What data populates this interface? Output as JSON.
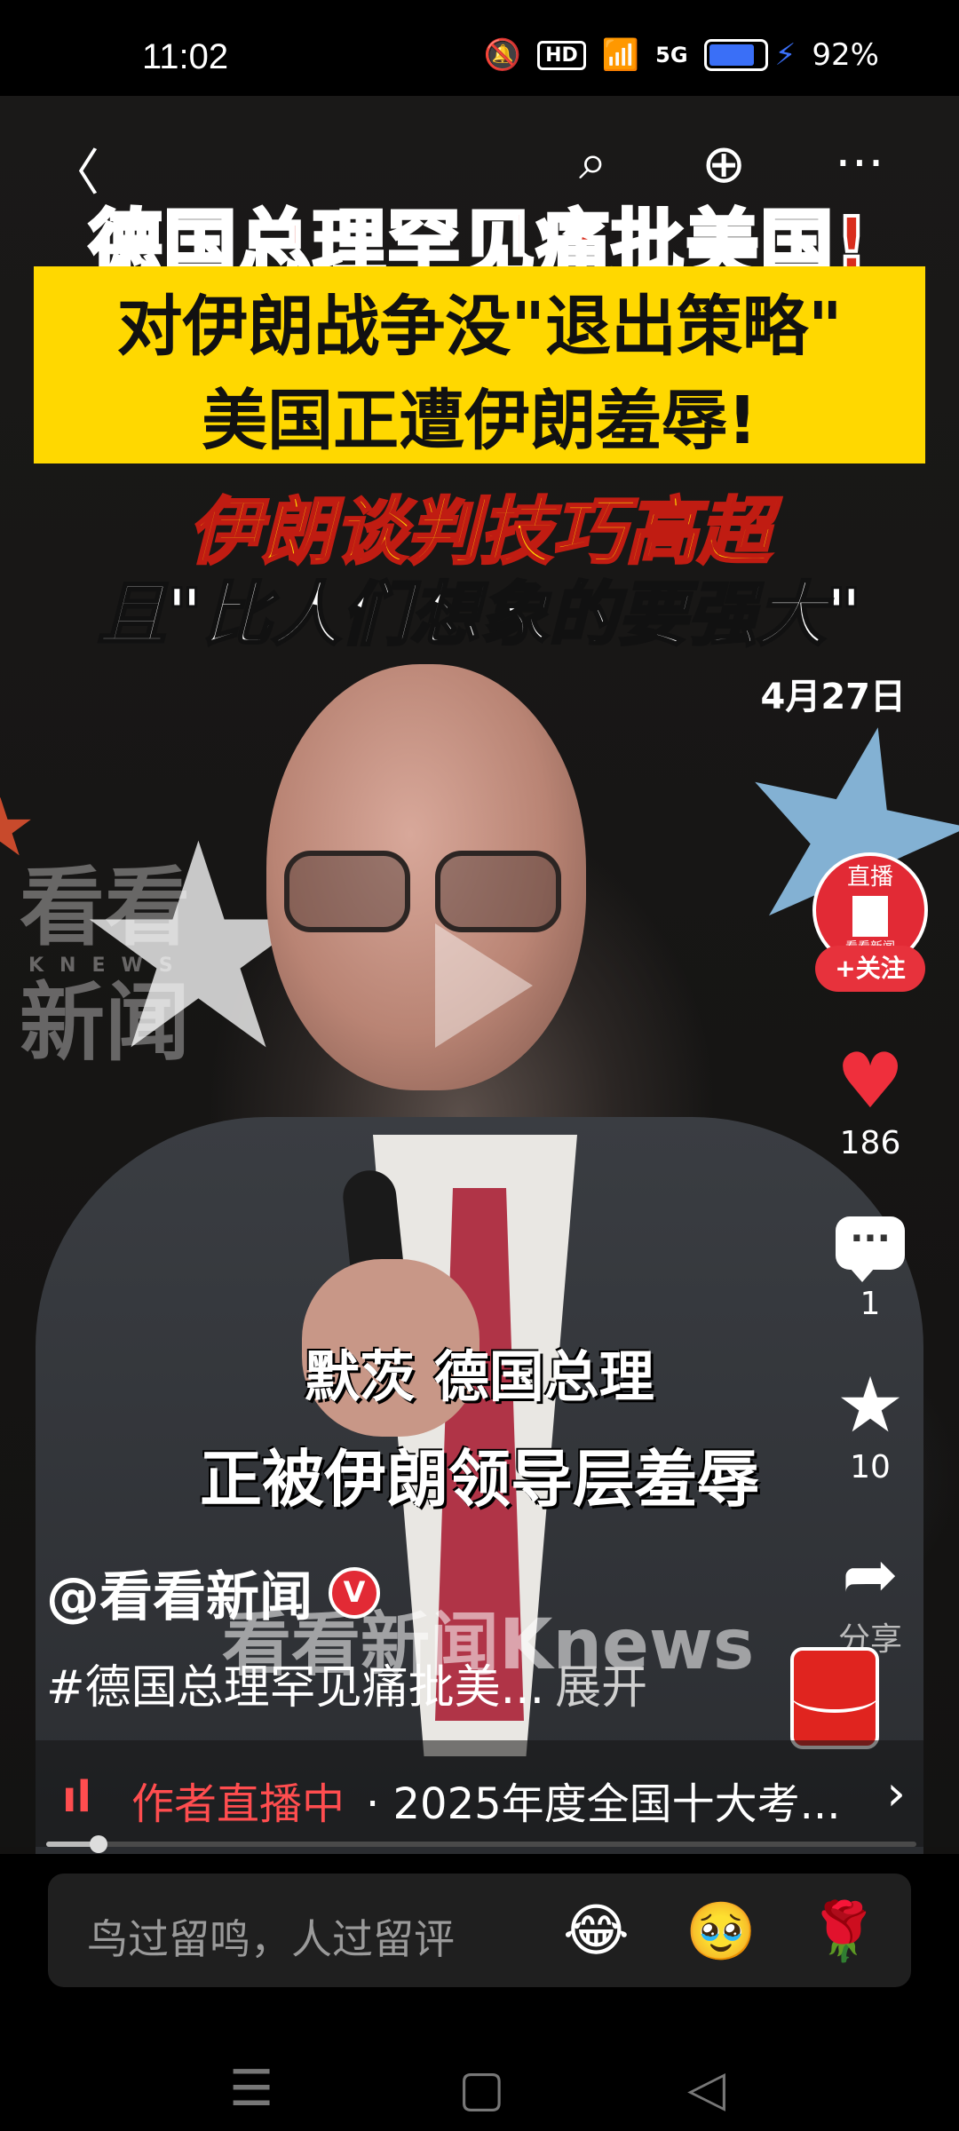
{
  "status_bar": {
    "time": "11:02",
    "icons": [
      "mute-icon",
      "hd-icon",
      "wifi-icon",
      "5g-signal-icon",
      "battery-icon",
      "charging-icon"
    ],
    "hd": "HD",
    "network": "5G",
    "battery_percent": "92%",
    "battery_level": 0.92
  },
  "video": {
    "headline_red": "德国总理罕见痛批美国!",
    "yellow_line1": "对伊朗战争没\"退出策略\"",
    "yellow_line2": "美国正遭伊朗羞辱!",
    "headline_gold": "伊朗谈判技巧高超",
    "headline_white": "且\"比人们想象的要强大\"",
    "date": "4月27日",
    "watermark_line1": "看看",
    "watermark_knews": "KNEWS",
    "watermark_line2": "新闻",
    "caption1": "默茨 德国总理",
    "caption2": "正被伊朗领导层羞辱",
    "knews_watermark": "看看新闻Knews"
  },
  "right_rail": {
    "avatar_live": "直播",
    "avatar_name": "看看新闻",
    "follow": "+关注",
    "likes": "186",
    "comments": "1",
    "favorites": "10",
    "share": "分享"
  },
  "post": {
    "author": "@看看新闻",
    "verified_badge": "V",
    "tag": "#德国总理罕见痛批美...",
    "expand": "展开"
  },
  "live_bar": {
    "label": "作者直播中",
    "text": "· 2025年度全国十大考...",
    "progress": 0.06
  },
  "comment_input": {
    "placeholder": "鸟过留鸣，人过留评",
    "emojis": [
      "😂",
      "🥹",
      "🌹"
    ]
  },
  "colors": {
    "accent_red": "#ef2f3c",
    "headline_yellow": "#ffd800"
  }
}
